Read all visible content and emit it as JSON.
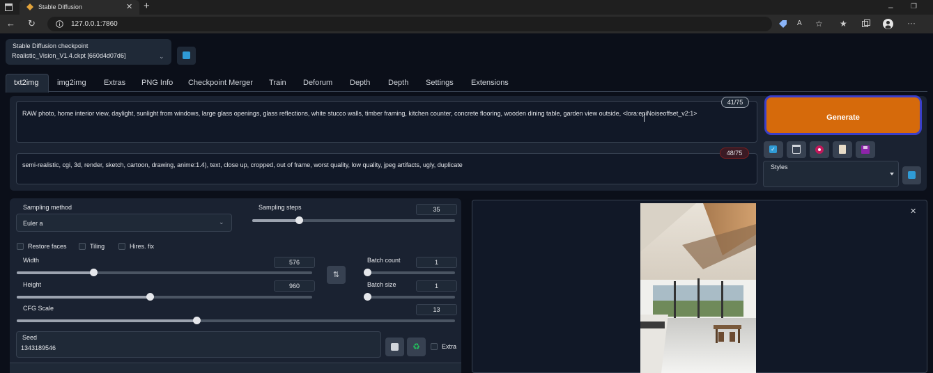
{
  "browser": {
    "tab_title": "Stable Diffusion",
    "url": "127.0.0.1:7860",
    "new_tab_symbol": "+",
    "minimize_symbol": "–",
    "restore_symbol": "❐"
  },
  "checkpoint": {
    "label": "Stable Diffusion checkpoint",
    "value": "Realistic_Vision_V1.4.ckpt [660d4d07d6]"
  },
  "tabs": [
    {
      "label": "txt2img"
    },
    {
      "label": "img2img"
    },
    {
      "label": "Extras"
    },
    {
      "label": "PNG Info"
    },
    {
      "label": "Checkpoint Merger"
    },
    {
      "label": "Train"
    },
    {
      "label": "Deforum"
    },
    {
      "label": "Depth"
    },
    {
      "label": "Depth"
    },
    {
      "label": "Settings"
    },
    {
      "label": "Extensions"
    }
  ],
  "prompt": {
    "text": "RAW photo, home interior view, daylight, sunlight from windows, large glass openings, glass reflections, white stucco walls, timber framing, kitchen counter, concrete flooring, wooden dining table, garden view outside, <lora:epiNoiseoffset_v2:1>",
    "token_count": "41/75"
  },
  "negative_prompt": {
    "text": "semi-realistic, cgi, 3d, render, sketch, cartoon, drawing, anime:1.4), text, close up, cropped, out of frame, worst quality, low quality, jpeg artifacts, ugly, duplicate",
    "token_count": "48/75"
  },
  "generate_label": "Generate",
  "styles_label": "Styles",
  "sampling": {
    "method_label": "Sampling method",
    "method_value": "Euler a",
    "steps_label": "Sampling steps",
    "steps_value": "35",
    "steps_fraction": 0.23
  },
  "options": {
    "restore_faces": "Restore faces",
    "tiling": "Tiling",
    "hires_fix": "Hires. fix"
  },
  "width": {
    "label": "Width",
    "value": "576",
    "fraction": 0.26
  },
  "height": {
    "label": "Height",
    "value": "960",
    "fraction": 0.45
  },
  "batch_count": {
    "label": "Batch count",
    "value": "1",
    "fraction": 0.0
  },
  "batch_size": {
    "label": "Batch size",
    "value": "1",
    "fraction": 0.0
  },
  "cfg": {
    "label": "CFG Scale",
    "value": "13",
    "fraction": 0.41
  },
  "seed": {
    "label": "Seed",
    "value": "1343189546",
    "extra_label": "Extra"
  },
  "colors": {
    "generate_bg": "#d66a0b",
    "generate_outline": "#3b3fc9",
    "page_bg": "#0b0f19",
    "panel_bg": "#1f2937",
    "accent_blue": "#2f9bd6"
  }
}
